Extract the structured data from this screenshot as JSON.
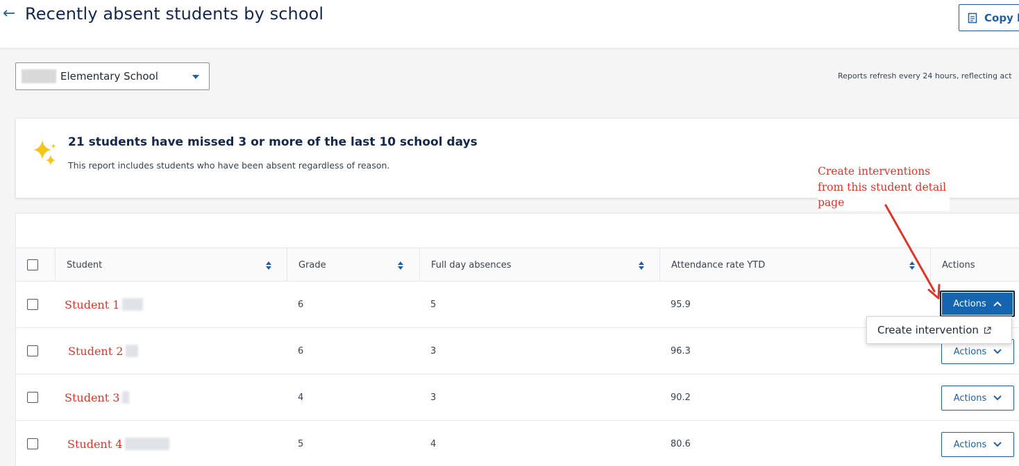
{
  "header": {
    "back_icon": "←",
    "title": "Recently absent students by school",
    "copy_label": "Copy l"
  },
  "filter": {
    "school_selected": "Elementary School",
    "refresh_note": "Reports refresh every 24 hours, reflecting act"
  },
  "summary": {
    "title": "21 students have missed 3 or more of the last 10 school days",
    "description": "This report includes students who have been absent regardless of reason."
  },
  "table": {
    "headers": [
      "Student",
      "Grade",
      "Full day absences",
      "Attendance rate YTD",
      "Actions"
    ],
    "rows": [
      {
        "student": "Student 1",
        "grade": "6",
        "absences": "5",
        "rate": "95.9",
        "action": "Actions"
      },
      {
        "student": "Student 2",
        "grade": "6",
        "absences": "3",
        "rate": "96.3",
        "action": "Actions"
      },
      {
        "student": "Student 3",
        "grade": "4",
        "absences": "3",
        "rate": "90.2",
        "action": "Actions"
      },
      {
        "student": "Student 4",
        "grade": "5",
        "absences": "4",
        "rate": "80.6",
        "action": "Actions"
      }
    ]
  },
  "dropdown": {
    "item": "Create intervention"
  },
  "annotation": {
    "text": "Create interventions\nfrom this student detail\npage"
  },
  "colors": {
    "primary": "#1f5fa6",
    "active_button": "#1565b0",
    "annotation": "#e0342a",
    "title": "#13294b",
    "sparkle": "#f5c518"
  }
}
